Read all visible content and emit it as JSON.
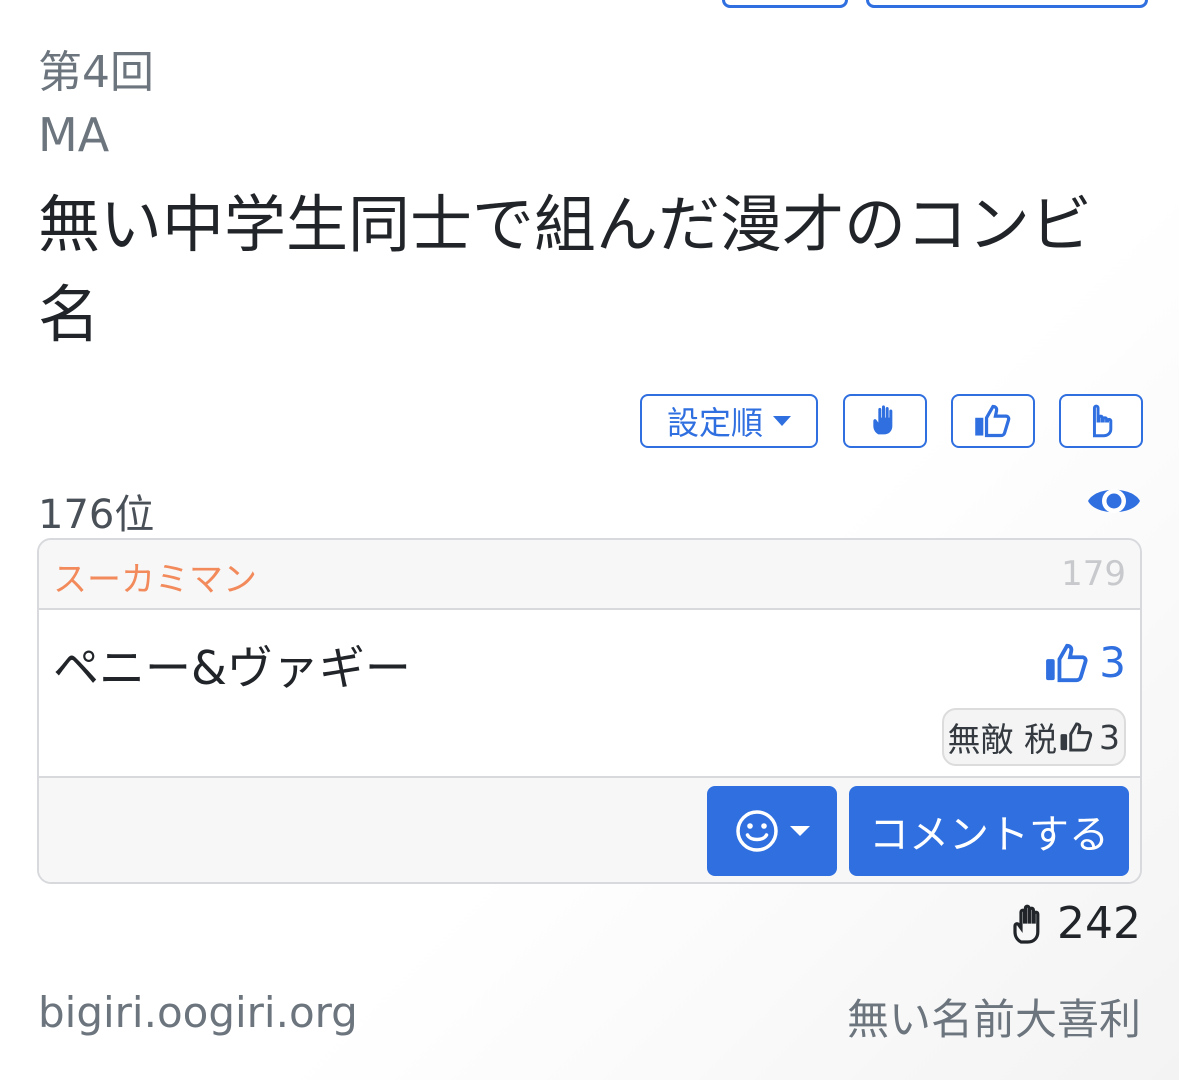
{
  "header": {
    "round": "第4回",
    "rule": "MA",
    "theme": "無い中学生同士で組んだ漫才のコンビ名"
  },
  "toolbar": {
    "sort_label": "設定順",
    "buttons": [
      "hand-icon",
      "thumbs-up-icon",
      "pointing-hand-icon"
    ]
  },
  "answer": {
    "rank": "176位",
    "author": "スーカミマン",
    "number": "179",
    "text": "ペニー&ヴァギー",
    "likes": "3",
    "liker_label": "無敵 税",
    "liker_count": "3"
  },
  "actions": {
    "comment_label": "コメントする",
    "emoji_icon": "smile-icon"
  },
  "stats": {
    "hand_count": "242"
  },
  "footer": {
    "site": "bigiri.oogiri.org",
    "site_name": "無い名前大喜利"
  },
  "colors": {
    "accent": "#2f6fe0",
    "author": "#f28a5b",
    "muted": "#6c757d"
  }
}
